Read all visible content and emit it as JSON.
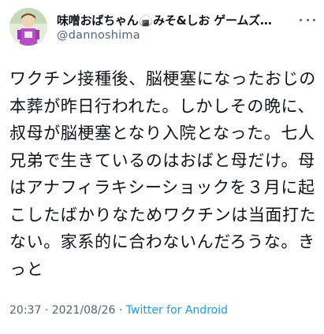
{
  "tweet": {
    "display_name": "味噌おばちゃん🍙みそ&しお ゲームズ…",
    "handle": "@dannoshima",
    "body": "ワクチン接種後、脳梗塞になったおじの本葬が昨日行われた。しかしその晩に、叔母が脳梗塞となり入院となった。七人兄弟で生きているのはおばと母だけ。母はアナフィラキシーショックを３月に起こしたばかりなためワクチンは当面打たない。家系的に合わないんだろうな。きっと",
    "time": "20:37",
    "separator": "·",
    "date": "2021/08/26",
    "source": "Twitter for Android"
  },
  "icons": {
    "avatar": "avatar-image",
    "more": "more-horizontal-icon"
  },
  "colors": {
    "text": "#0f1419",
    "secondary": "#536471",
    "link": "#1d9bf0"
  }
}
